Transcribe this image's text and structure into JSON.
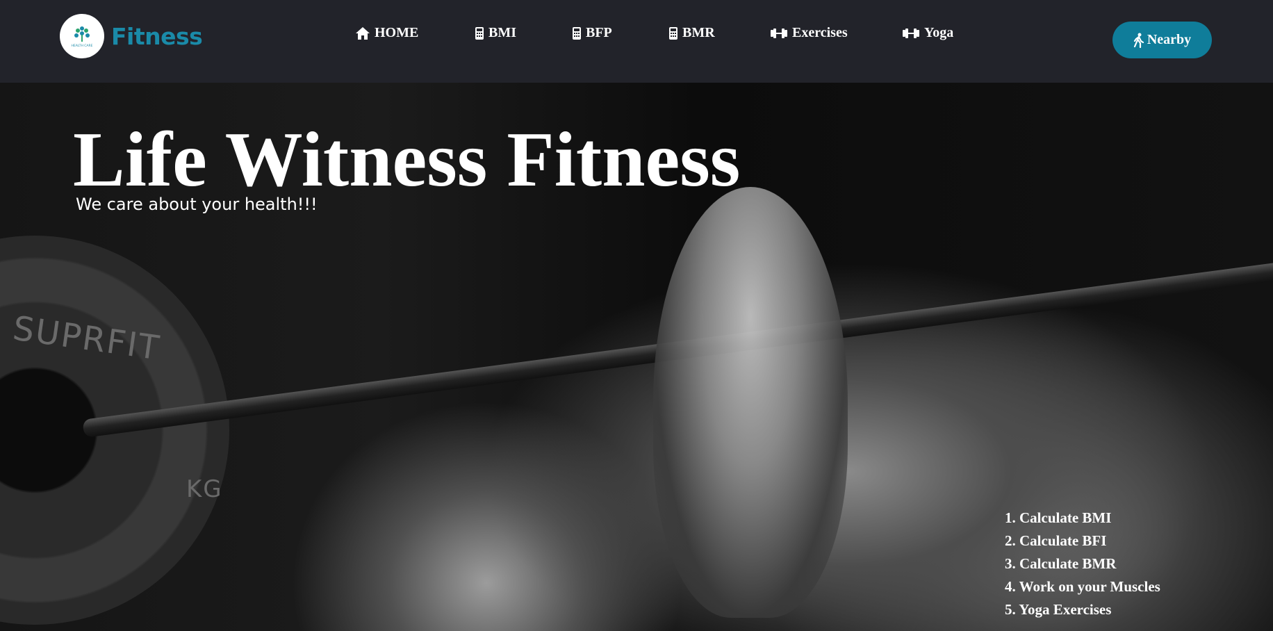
{
  "header": {
    "brand": "Fitness",
    "logo_text": "HEALTH CARE",
    "nav": [
      {
        "label": "HOME",
        "icon": "home-icon"
      },
      {
        "label": "BMI",
        "icon": "calculator-icon"
      },
      {
        "label": "BFP",
        "icon": "calculator-icon"
      },
      {
        "label": "BMR",
        "icon": "calculator-icon"
      },
      {
        "label": "Exercises",
        "icon": "dumbbell-icon"
      },
      {
        "label": "Yoga",
        "icon": "dumbbell-icon"
      }
    ],
    "nearby_label": "Nearby",
    "nearby_icon": "walking-icon"
  },
  "hero": {
    "title": "Life Witness Fitness",
    "subtitle": "We care about your health!!!",
    "plate_text_1": "SUPRFIT",
    "plate_text_2": "KG",
    "features": [
      "1. Calculate BMI",
      "2. Calculate BFI",
      "3. Calculate BMR",
      "4. Work on your Muscles",
      "5. Yoga Exercises"
    ]
  },
  "colors": {
    "header_bg": "#22232a",
    "brand": "#1a8aa8",
    "button_bg": "#0f7d9a"
  }
}
